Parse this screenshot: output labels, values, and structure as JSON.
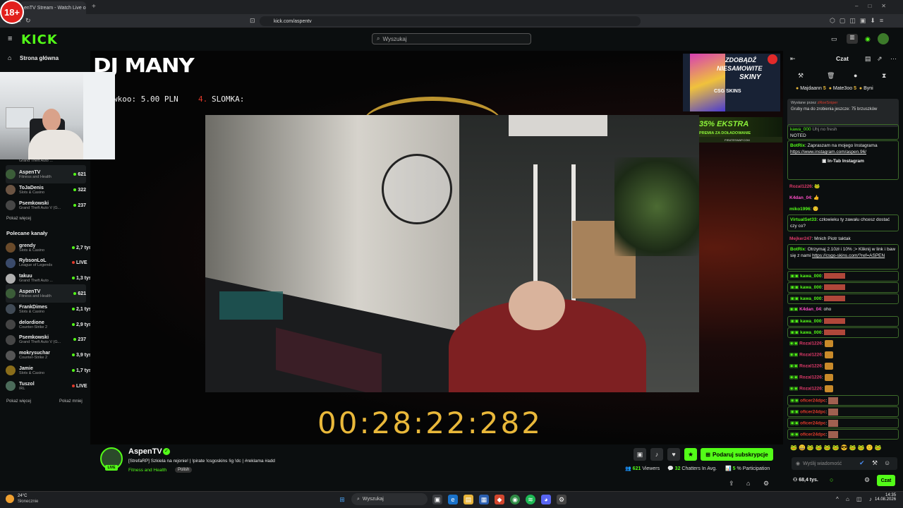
{
  "browser": {
    "age_badge": "18+",
    "tab_title": "enTV Stream - Watch Live o",
    "url": "kick.com/aspentv"
  },
  "header": {
    "logo": "KICK",
    "search_placeholder": "Wyszukaj"
  },
  "sidebar": {
    "home": "Strona główna",
    "followed": [
      {
        "name": "AspenTV",
        "game": "Fitness and Health",
        "viewers": "621"
      },
      {
        "name": "ToJaDenis",
        "game": "Slots & Casino",
        "viewers": "322"
      },
      {
        "name": "Psemkowski",
        "game": "Grand Theft Auto V (G...",
        "viewers": "237"
      }
    ],
    "partial_game": "Grand Theft Auto ...",
    "show_more": "Pokaż więcej",
    "recommended_title": "Polecane kanały",
    "recommended": [
      {
        "name": "grendy",
        "game": "Slots & Casino",
        "viewers": "2,7 tys."
      },
      {
        "name": "RybsonLoL",
        "game": "League of Legends",
        "viewers": "LIVE"
      },
      {
        "name": "takuu",
        "game": "Grand Theft Auto ...",
        "viewers": "1,3 tys."
      },
      {
        "name": "AspenTV",
        "game": "Fitness and Health",
        "viewers": "621"
      },
      {
        "name": "FrankDimes",
        "game": "Slots & Casino",
        "viewers": "2,1 tys."
      },
      {
        "name": "delordione",
        "game": "Counter-Strike 2",
        "viewers": "2,9 tys."
      },
      {
        "name": "Psemkowski",
        "game": "Grand Theft Auto V (G...",
        "viewers": "237"
      },
      {
        "name": "mokrysuchar",
        "game": "Counter-Strike 2",
        "viewers": "3,9 tys."
      },
      {
        "name": "Jamie",
        "game": "Slots & Casino",
        "viewers": "1,7 tys."
      },
      {
        "name": "Tuszol",
        "game": "IRL",
        "viewers": "LIVE"
      }
    ],
    "show_more2": "Pokaż więcej",
    "show_less": "Pokaż mniej"
  },
  "player": {
    "overlay_title": "DJ MANY",
    "ticker_left": "wkoo: 5.00 PLN",
    "ticker_num": "4.",
    "ticker_right": "SLOMKA:",
    "timer": "00:28:22:282",
    "ad1_line1": "ZDOBĄDŹ",
    "ad1_line2": "NIESAMOWITE",
    "ad1_line3": "SKINY",
    "ad1_brand": "CSG SKINS",
    "ad2_line1": "35% EKSTRA",
    "ad2_line2": "PREMIA ZA DOŁADOWANIE",
    "ad2_brand": "PIRATESWAP.COM"
  },
  "stream": {
    "name": "AspenTV",
    "live": "LIVE",
    "title": "[StrefaRP] Szkiela na rejonie! | !pirate !csgoskins !ig !dc | #reklama #add",
    "category": "Fitness and Health",
    "tag": "Polish",
    "subscribe": "Podaruj subskrypcje",
    "viewers_num": "621",
    "viewers_label": "Viewers",
    "chatters_num": "32",
    "chatters_label": "Chatters In Avg.",
    "participation_num": "5",
    "participation_label": "% Participation"
  },
  "chat": {
    "title": "Czat",
    "gifters": [
      {
        "name": "Majdaann",
        "count": "5"
      },
      {
        "name": "Mate3oo",
        "count": "5"
      },
      {
        "name": "Byni",
        "count": ""
      }
    ],
    "pinned_by_label": "Wysłane przez",
    "pinned_by": "zRoeSniper",
    "pinned_text": "Gruby ma do zrobienia jeszcze: 75 brzuszków",
    "noted_user": "kawa_000",
    "noted_text": "NOTED",
    "noted_mid": "Uhj no fresh",
    "botrix1_user": "BotRix",
    "botrix1_text": "Zapraszam na mojego Instagrama",
    "botrix1_link": "https://www.instagram.com/aspen.96/",
    "botrix1_btn": "In-Tab Instagram",
    "messages": [
      {
        "user": "Rozal1226",
        "text": "",
        "color": "#ff4fc8"
      },
      {
        "user": "K4dan_04",
        "text": "",
        "color": "#ff4fc8"
      },
      {
        "user": "miko1996",
        "text": "",
        "color": "#53fc18"
      }
    ],
    "virtual_user": "VirtualSet33",
    "virtual_text": "człowieku ty zawału chcesz dostać czy co?",
    "mejker_user": "Mejker247",
    "mejker_text": "Mnich Piotr taktak",
    "botrix2_user": "BotRix",
    "botrix2_text": "Otrzymaj 2.10zł i 10% ;> Kliknij w link i baw się z nami",
    "botrix2_link": "https://csgo-skins.com/?ref=ASPEN",
    "kawa_user": "kawa_000",
    "k4dan_text": "oho",
    "rozal_user": "Rozal1226",
    "oficer_user": "oficer24dpc",
    "input_placeholder": "Wyślij wiadomość",
    "points": "68,4 tys.",
    "send": "Czat"
  },
  "taskbar": {
    "temp": "24°C",
    "weather": "Słonecznie",
    "search": "Wyszukaj",
    "time": "14:35",
    "date": "14.08.2026"
  },
  "colors": {
    "accent": "#53fc18",
    "background": "#0b0e0f",
    "timer": "#e9b83a"
  }
}
